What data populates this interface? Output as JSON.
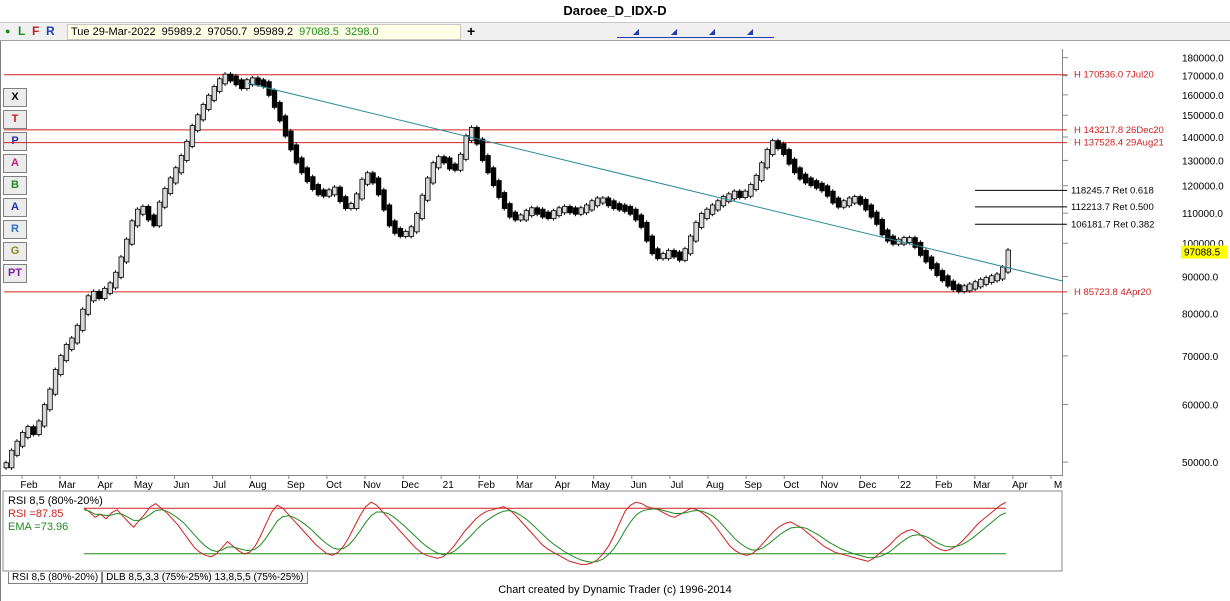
{
  "window": {
    "title": "Daroee_D_IDX-D"
  },
  "toolbar": {
    "buttons": [
      "L",
      "F",
      "R"
    ],
    "info": {
      "date": "Tue 29-Mar-2022",
      "open": "95989.2",
      "high": "97050.7",
      "low": "95989.2",
      "close": "97088.5",
      "change": "3298.0"
    },
    "plus": "+"
  },
  "left_tools": [
    "X",
    "T",
    "P",
    "A",
    "B",
    "A",
    "R",
    "G",
    "PT"
  ],
  "chart_data": [
    {
      "type": "bar",
      "title": "Daroee_D_IDX-D",
      "x_ticks": [
        "Feb",
        "Mar",
        "Apr",
        "May",
        "Jun",
        "Jul",
        "Aug",
        "Sep",
        "Oct",
        "Nov",
        "Dec",
        "21",
        "Feb",
        "Mar",
        "Apr",
        "May",
        "Jun",
        "Jul",
        "Aug",
        "Sep",
        "Oct",
        "Nov",
        "Dec",
        "22",
        "Feb",
        "Mar",
        "Apr",
        "M"
      ],
      "y_ticks": [
        "180000.0",
        "170000.0",
        "160000.0",
        "150000.0",
        "140000.0",
        "130000.0",
        "120000.0",
        "110000.0",
        "100000.0",
        "90000.0",
        "80000.0",
        "70000.0",
        "60000.0",
        "50000.0"
      ],
      "ylim": [
        48000,
        185000
      ],
      "y_scale": "log",
      "last_price_label": "97088.5",
      "series": [
        {
          "values": [
            49500,
            51500,
            53000,
            54500,
            55500,
            55000,
            56500,
            59500,
            62500,
            66500,
            69500,
            72000,
            73500,
            76500,
            80500,
            84000,
            85200,
            84600,
            86000,
            87500,
            90500,
            95000,
            100500,
            106500,
            110500,
            111500,
            108500,
            106500,
            113000,
            118000,
            122000,
            126000,
            131000,
            137000,
            144000,
            149000,
            154000,
            158500,
            163000,
            167000,
            169500,
            168500,
            166500,
            164500,
            166500,
            167500,
            166500,
            165500,
            161000,
            155000,
            148500,
            141500,
            135500,
            130000,
            126000,
            122500,
            119500,
            117500,
            117000,
            117500,
            118500,
            115000,
            112500,
            112500,
            116000,
            121500,
            124000,
            122000,
            117500,
            112000,
            106500,
            104000,
            103000,
            103000,
            104500,
            109000,
            115500,
            122000,
            128000,
            130500,
            130000,
            127500,
            127000,
            131500,
            139500,
            143200,
            138000,
            131000,
            126000,
            121000,
            116500,
            112500,
            109500,
            108500,
            108500,
            110000,
            111000,
            110500,
            109500,
            109000,
            110000,
            111000,
            111500,
            111000,
            110500,
            111000,
            112000,
            113500,
            114500,
            114500,
            113500,
            112500,
            112000,
            111500,
            110500,
            108500,
            106000,
            101500,
            97500,
            96000,
            96000,
            97000,
            96500,
            95500,
            97500,
            101500,
            106000,
            109000,
            110500,
            112000,
            113500,
            115000,
            116000,
            117000,
            116500,
            117000,
            119500,
            123000,
            128000,
            133500,
            137300,
            136000,
            133500,
            129500,
            126000,
            123500,
            122000,
            121000,
            120000,
            119000,
            117000,
            114500,
            113000,
            113500,
            114500,
            115000,
            114000,
            112000,
            109500,
            107000,
            103500,
            101500,
            100500,
            100500,
            101000,
            101000,
            99500,
            97000,
            95000,
            93000,
            91000,
            89500,
            88000,
            87000,
            86500,
            86700,
            87200,
            87800,
            88500,
            89000,
            89500,
            90000,
            92000,
            97088.5
          ]
        }
      ],
      "annotations": [
        {
          "label": "H 170536.0 7Jul20",
          "value": 170536.0
        },
        {
          "label": "H 143217.8 26Dec20",
          "value": 143217.8
        },
        {
          "label": "H 137528.4 29Aug21",
          "value": 137528.4
        },
        {
          "label": "118245.7 Ret 0.618",
          "value": 118245.7
        },
        {
          "label": "112213.7 Ret 0.500",
          "value": 112213.7
        },
        {
          "label": "106181.7 Ret 0.382",
          "value": 106181.7
        },
        {
          "label": "H 85723.8 4Apr20",
          "value": 85723.8
        }
      ],
      "colors": {
        "resistance": "#d02020",
        "trendline": "#2b8a9b",
        "retracement": "#000000",
        "last_price_bg": "#ffff00"
      }
    },
    {
      "type": "line",
      "title": "RSI 8,5 (80%-20%)",
      "ylim": [
        0,
        100
      ],
      "levels": [
        80,
        20
      ],
      "readouts": [
        {
          "label": "RSI =",
          "value": "87.85",
          "color": "#d02020"
        },
        {
          "label": "EMA =",
          "value": "73.96",
          "color": "#1f8a1f"
        }
      ],
      "series": [
        {
          "name": "RSI",
          "values": [
            80,
            75,
            68,
            72,
            66,
            74,
            78,
            70,
            62,
            55,
            64,
            72,
            82,
            86,
            80,
            74,
            66,
            58,
            48,
            38,
            28,
            22,
            18,
            16,
            20,
            28,
            36,
            30,
            24,
            20,
            22,
            30,
            44,
            60,
            75,
            84,
            80,
            72,
            64,
            56,
            48,
            40,
            32,
            26,
            20,
            18,
            22,
            30,
            42,
            56,
            70,
            82,
            88,
            84,
            76,
            68,
            60,
            52,
            44,
            36,
            28,
            22,
            18,
            16,
            14,
            16,
            22,
            30,
            40,
            50,
            58,
            66,
            72,
            76,
            78,
            80,
            82,
            78,
            72,
            64,
            56,
            48,
            40,
            32,
            26,
            22,
            18,
            14,
            10,
            8,
            6,
            6,
            8,
            12,
            20,
            30,
            44,
            60,
            76,
            84,
            88,
            86,
            82,
            80,
            78,
            74,
            70,
            68,
            72,
            76,
            80,
            78,
            74,
            68,
            60,
            50,
            40,
            30,
            24,
            20,
            18,
            20,
            26,
            34,
            42,
            50,
            56,
            60,
            62,
            58,
            54,
            48,
            42,
            36,
            30,
            26,
            22,
            20,
            18,
            16,
            14,
            12,
            10,
            14,
            20,
            26,
            32,
            40,
            46,
            50,
            52,
            48,
            42,
            36,
            30,
            26,
            24,
            26,
            30,
            36,
            44,
            52,
            60,
            66,
            72,
            78,
            84,
            87.85
          ]
        },
        {
          "name": "EMA",
          "values": [
            78,
            76,
            72,
            72,
            70,
            71,
            73,
            72,
            68,
            64,
            64,
            67,
            72,
            77,
            78,
            76,
            72,
            67,
            61,
            53,
            45,
            37,
            30,
            25,
            23,
            25,
            29,
            29,
            27,
            25,
            24,
            26,
            32,
            41,
            52,
            63,
            69,
            70,
            68,
            64,
            59,
            53,
            46,
            39,
            33,
            28,
            26,
            27,
            32,
            40,
            50,
            61,
            70,
            75,
            75,
            73,
            69,
            63,
            57,
            50,
            43,
            36,
            30,
            25,
            21,
            19,
            20,
            23,
            29,
            36,
            43,
            51,
            58,
            64,
            69,
            73,
            76,
            77,
            75,
            71,
            66,
            60,
            53,
            46,
            39,
            33,
            28,
            23,
            19,
            15,
            12,
            10,
            9,
            10,
            13,
            19,
            27,
            38,
            51,
            62,
            71,
            76,
            78,
            79,
            79,
            77,
            75,
            73,
            73,
            74,
            76,
            77,
            76,
            73,
            69,
            63,
            55,
            47,
            39,
            33,
            28,
            25,
            25,
            28,
            33,
            39,
            45,
            50,
            54,
            55,
            55,
            53,
            49,
            45,
            40,
            35,
            31,
            27,
            24,
            21,
            19,
            17,
            15,
            15,
            16,
            19,
            23,
            29,
            35,
            40,
            44,
            45,
            44,
            41,
            37,
            33,
            30,
            29,
            30,
            32,
            36,
            41,
            47,
            53,
            59,
            65,
            71,
            73.96
          ]
        }
      ]
    }
  ],
  "bottom_tabs": [
    "RSI 8,5 (80%-20%)",
    "DLB 8,5,3,3 (75%-25%) 13,8,5,5 (75%-25%)"
  ],
  "footer": "Chart created by Dynamic Trader  (c) 1996-2014"
}
